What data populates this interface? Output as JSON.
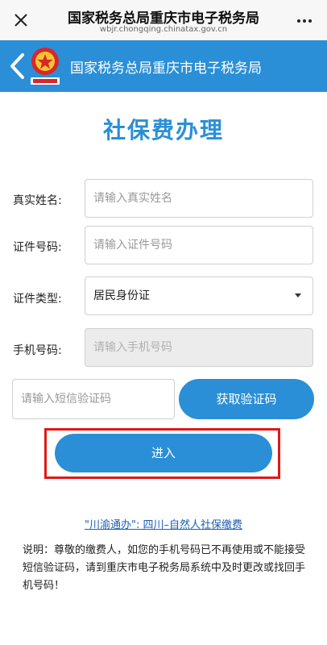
{
  "topbar": {
    "title": "国家税务总局重庆市电子税务局",
    "url": "wbjr.chongqing.chinatax.gov.cn"
  },
  "header": {
    "title": "国家税务总局重庆市电子税务局"
  },
  "page": {
    "title": "社保费办理"
  },
  "form": {
    "name_label": "真实姓名:",
    "name_placeholder": "请输入真实姓名",
    "id_label": "证件号码:",
    "id_placeholder": "请输入证件号码",
    "id_type_label": "证件类型:",
    "id_type_value": "居民身份证",
    "phone_label": "手机号码:",
    "phone_placeholder": "请输入手机号码",
    "sms_placeholder": "请输入短信验证码",
    "get_code_label": "获取验证码",
    "enter_label": "进入"
  },
  "footer": {
    "link_text": "\"川渝通办\": 四川–自然人社保缴费",
    "note": "说明：尊敬的缴费人，如您的手机号码已不再使用或不能接受短信验证码，请到重庆市电子税务局系统中及时更改或找回手机号码！"
  },
  "colors": {
    "brand_blue": "#2a8fd6",
    "highlight_red": "#e01818"
  }
}
